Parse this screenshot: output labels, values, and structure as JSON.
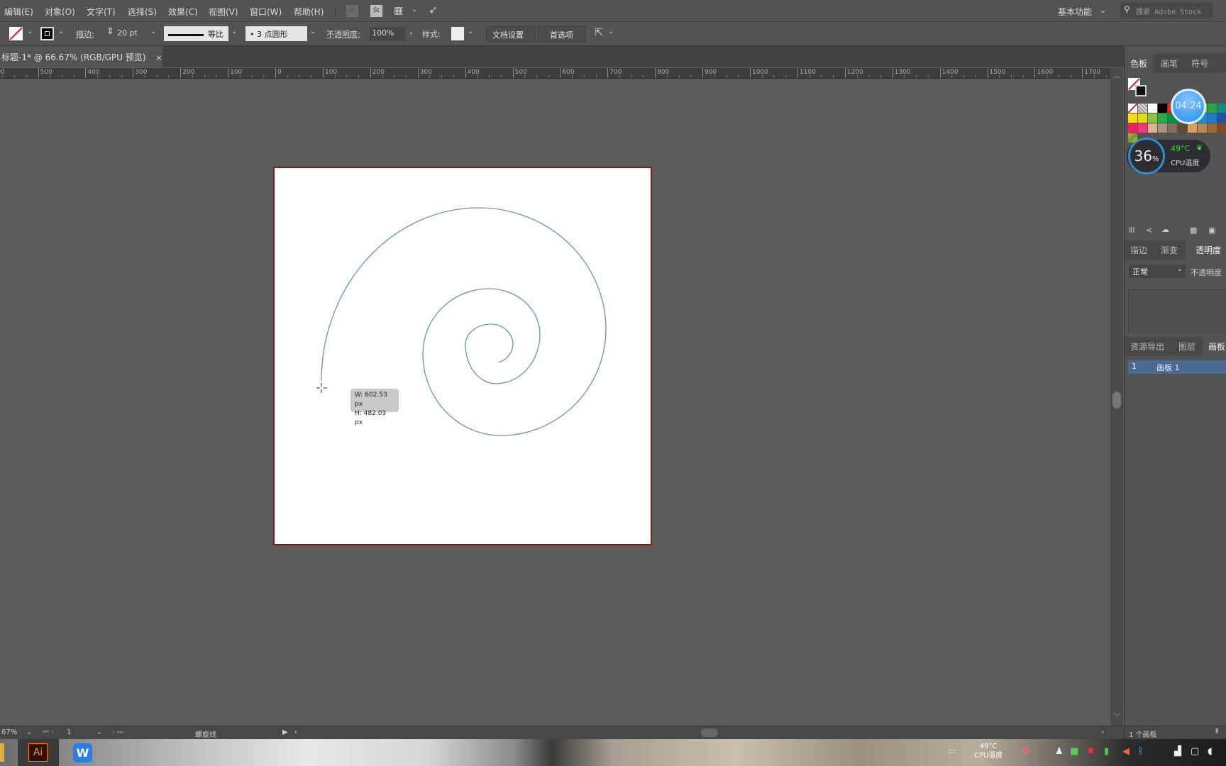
{
  "app": {
    "name": "Adobe Illustrator"
  },
  "menubar": {
    "items": [
      "编辑(E)",
      "对象(O)",
      "文字(T)",
      "选择(S)",
      "效果(C)",
      "视图(V)",
      "窗口(W)",
      "帮助(H)"
    ],
    "bridge": "Br",
    "stock": "St",
    "workspace": "基本功能",
    "search_placeholder": "搜索 Adobe Stock"
  },
  "controlbar": {
    "stroke_label": "描边:",
    "stroke_weight": "20 pt",
    "stroke_profile": "等比",
    "brush": "•  3 点圆形",
    "opacity_label": "不透明度:",
    "opacity_value": "100%",
    "style_label": "样式:",
    "doc_setup": "文档设置",
    "preferences": "首选项"
  },
  "document_tab": {
    "title": "标题-1* @ 66.67% (RGB/GPU 预览)",
    "close": "×"
  },
  "ruler": {
    "labels": [
      "600",
      "500",
      "400",
      "300",
      "200",
      "100",
      "0",
      "100",
      "200",
      "300",
      "400",
      "500",
      "600",
      "700",
      "800",
      "900",
      "1000",
      "1100",
      "1200",
      "1300",
      "1400",
      "1500",
      "1600",
      "1700"
    ]
  },
  "canvas": {
    "artboard_border_color": "#7a1f1f",
    "spiral_color": "#6f8fb8",
    "tooltip": {
      "w": "W: 602.53 px",
      "h": "H: 482.03 px"
    }
  },
  "right_panel": {
    "tabs_top": [
      "色板",
      "画笔",
      "符号"
    ],
    "swatch_rows": [
      [
        "none",
        "reg",
        "#ffffff",
        "#000000",
        "#e8231f",
        "#f0a020",
        "#f5e51c",
        "#8cc43c",
        "#2f9e48",
        "#138a7a",
        "#0f5cf2",
        "#e53ae0"
      ],
      [
        "#f4dd16",
        "#e2d91f",
        "#8dc149",
        "#2ca94b",
        "#0c8c47",
        "#118f7f",
        "#19a0a3",
        "#1d8fd8",
        "#2277c6",
        "#22529b",
        "#5c2c90",
        "#8b1c7f"
      ],
      [
        "#e52466",
        "#ec3a82",
        "#d4b796",
        "#a89380",
        "#82705f",
        "#5e4a3b",
        "#d2a065",
        "#b78652",
        "#9b6a3c",
        "#7c4e27",
        "#6b3f21",
        "#573217"
      ]
    ],
    "tabs_mid": [
      "描边",
      "渐变",
      "透明度"
    ],
    "blend_mode": "正常",
    "opacity_label": "不透明度",
    "tabs_bottom": [
      "资源导出",
      "图层",
      "画板"
    ],
    "artboards": [
      {
        "index": "1",
        "name": "画板 1"
      }
    ],
    "artboard_count": "1 个画板"
  },
  "overlays": {
    "clock": "04:24",
    "cpu_usage": "36",
    "cpu_unit": "%",
    "cpu_temp": "49°C",
    "cpu_temp_label": "CPU温度"
  },
  "statusbar": {
    "zoom": "67%",
    "artboard_num": "1",
    "tool": "螺旋线"
  },
  "taskbar": {
    "ai": "Ai",
    "wps": "W",
    "cpu_temp": "49°C",
    "cpu_temp_label": "CPU温度"
  }
}
